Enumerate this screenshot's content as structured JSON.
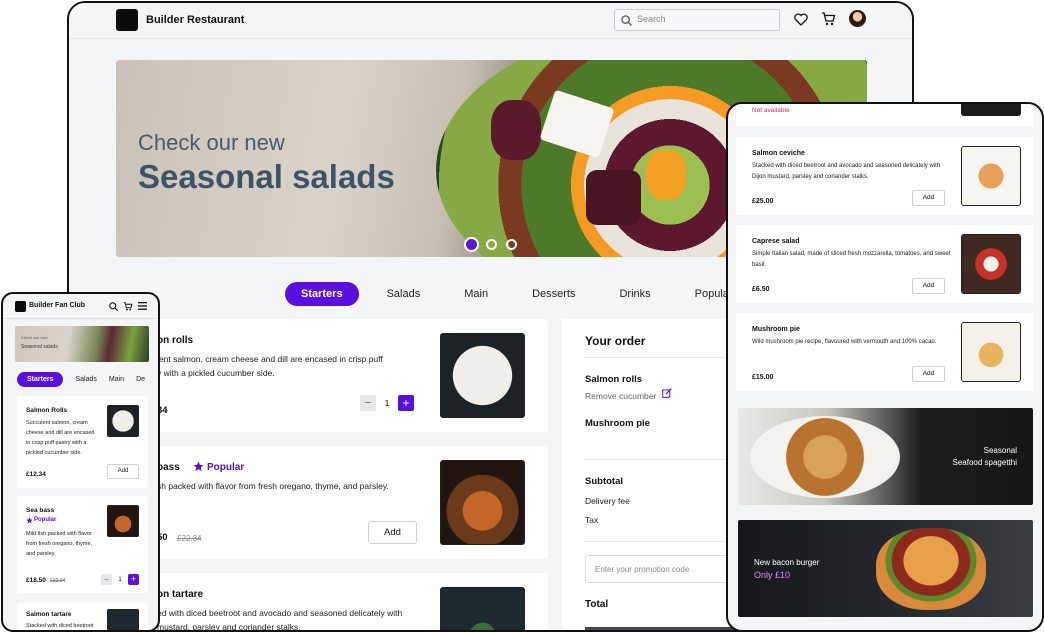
{
  "desktop": {
    "brand": "Builder Restaurant",
    "search_placeholder": "Search",
    "hero": {
      "subtitle": "Check our new",
      "title": "Seasonal salads"
    },
    "tabs": [
      "Starters",
      "Salads",
      "Main",
      "Desserts",
      "Drinks",
      "Popular"
    ],
    "active_tab": "Starters",
    "menu": [
      {
        "name": "on rolls",
        "desc1": "lent salmon, cream cheese and dill are encased in crisp puff",
        "desc2": "y with a pickled cucumber side.",
        "price": "34",
        "qty": "1"
      },
      {
        "name": "bass",
        "badge": "Popular",
        "desc1": "sh packed with flavor from fresh oregano, thyme, and parsley.",
        "price": "50",
        "old_price": "£22.34",
        "add": "Add"
      },
      {
        "name": "on tartare",
        "desc1": "ed with diced beetroot and avocado and seasoned delicately with",
        "desc2": "mustard, parsley and coriander stalks."
      }
    ],
    "order": {
      "title": "Your order",
      "item1": "Salmon rolls",
      "item1_note": "Remove cucumber",
      "item2": "Mushroom pie",
      "subtotal": "Subtotal",
      "delivery": "Delivery fee",
      "tax": "Tax",
      "promo_placeholder": "Enter your promotion code",
      "total": "Total"
    },
    "colors": {
      "accent": "#5a0fe0",
      "bg": "#f4f5f7"
    }
  },
  "mobile_left": {
    "brand": "Builder Fan Club",
    "hero_sub": "Check our new",
    "hero_title": "Seasonal salads",
    "tabs": [
      "Starters",
      "Salads",
      "Main",
      "De"
    ],
    "items": [
      {
        "name": "Salmon Rolls",
        "desc": "Succulent salmon, cream cheese and dill are encased in crisp puff pastry with a pickled cucumber side.",
        "price": "£12.34",
        "add": "Add"
      },
      {
        "name": "Sea bass",
        "badge": "Popular",
        "desc": "Mild fish packed with flavor from fresh oregano, thyme, and parsley.",
        "price": "£18.50",
        "old_price": "£22.34",
        "qty": "1"
      },
      {
        "name": "Salmon tartare",
        "desc": "Stacked with diced beetroot"
      }
    ]
  },
  "mobile_right": {
    "not_available": "Not available",
    "items": [
      {
        "name": "Salmon ceviche",
        "desc": "Stacked with diced beetroot and avocado and seasoned delicately with Dijon mustard, parsley and coriander stalks.",
        "price": "£25.00",
        "add": "Add"
      },
      {
        "name": "Caprese salad",
        "desc": "Simple Italian salad, made of sliced fresh mozzarella, tomatoes, and sweet basil.",
        "price": "£6.50",
        "add": "Add"
      },
      {
        "name": "Mushroom pie",
        "desc": "Wild mushroom pie recipe, flavoured with vermouth and 100% cacao.",
        "price": "£15.00",
        "add": "Add"
      }
    ],
    "banner1": {
      "line1": "Seasonal",
      "line2": "Seafood spagetthi"
    },
    "banner2": {
      "line1": "New bacon burger",
      "line2": "Only £10"
    }
  }
}
